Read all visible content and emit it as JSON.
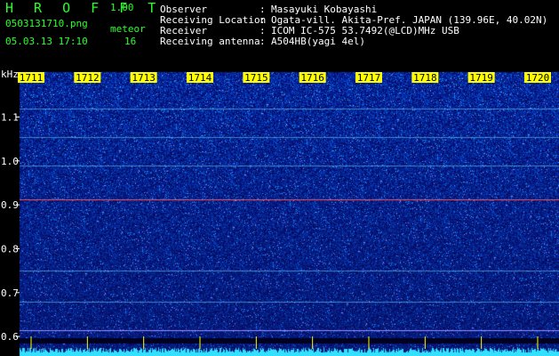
{
  "app": {
    "title": "H R O F F T",
    "version": "1.00",
    "filename": "0503131710.png",
    "datetime": "05.03.13 17:10",
    "meteor_label": "meteor",
    "meteor_count": "16"
  },
  "info": [
    {
      "key": "Observer",
      "value": "Masayuki Kobayashi"
    },
    {
      "key": "Receiving Location",
      "value": "Ogata-vill. Akita-Pref. JAPAN (139.96E, 40.02N)"
    },
    {
      "key": "Receiver",
      "value": "ICOM IC-575 53.7492(@LCD)MHz USB"
    },
    {
      "key": "Receiving antenna",
      "value": "A504HB(yagi 4el)"
    }
  ],
  "colon": ":",
  "spectrogram": {
    "y_unit": "kHz",
    "y_ticks": [
      "1.1",
      "1.0",
      "0.9",
      "0.8",
      "0.7",
      "0.6"
    ],
    "y_tick_values": [
      1.1,
      1.0,
      0.9,
      0.8,
      0.7,
      0.6
    ],
    "y_range": [
      0.58,
      1.18
    ],
    "time_ticks": [
      "1711",
      "1712",
      "1713",
      "1714",
      "1715",
      "1716",
      "1717",
      "1718",
      "1719",
      "1720"
    ],
    "carrier_freq_khz": 0.912,
    "colors": {
      "background": "#000000",
      "noise_dark": "#0a0a6e",
      "noise_bright": "#3c6cff",
      "carrier": "#ff5050",
      "baseline": "#33e0ff",
      "tick_text": "#ffffff",
      "time_band": "#ffff00"
    }
  }
}
